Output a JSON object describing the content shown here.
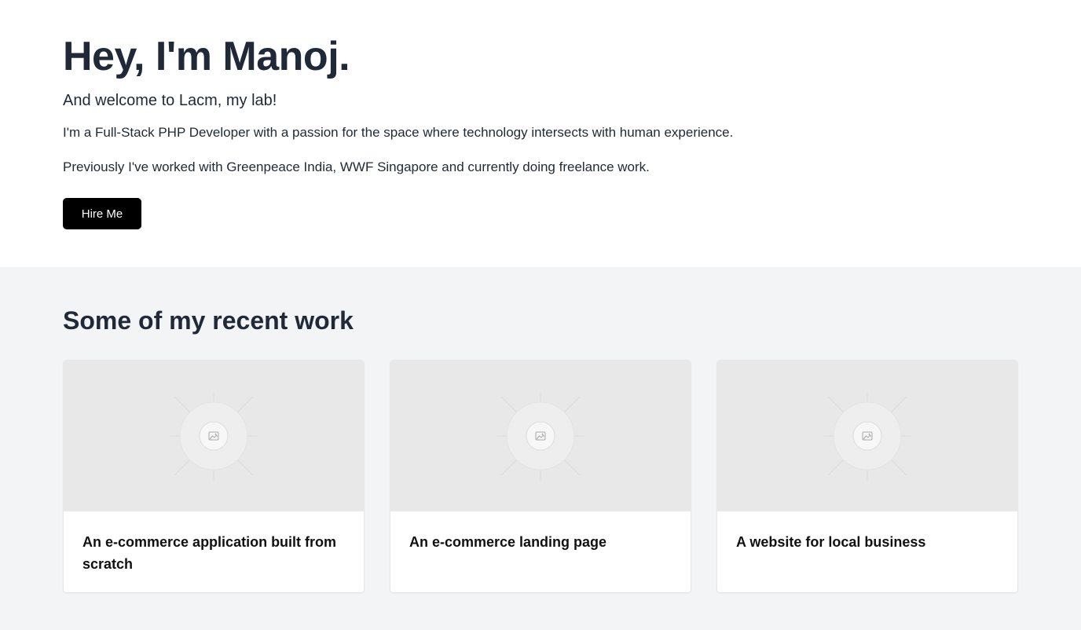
{
  "hero": {
    "heading": "Hey, I'm Manoj.",
    "welcome": "And welcome to Lacm, my lab!",
    "intro": "I'm a Full-Stack PHP Developer with a passion for the space where technology intersects with human experience.",
    "previous": "Previously I've worked with Greenpeace India, WWF Singapore and currently doing freelance work.",
    "hire_label": "Hire Me"
  },
  "work": {
    "heading": "Some of my recent work",
    "projects": [
      {
        "title": "An e-commerce application built from scratch",
        "thumb_icon": "image-placeholder-icon"
      },
      {
        "title": "An e-commerce landing page",
        "thumb_icon": "image-placeholder-icon"
      },
      {
        "title": "A website for local business",
        "thumb_icon": "image-placeholder-icon"
      }
    ]
  },
  "colors": {
    "text": "#1f2937",
    "button_bg": "#000000",
    "section_bg": "#f3f4f6",
    "placeholder_bg": "#e8e8e8"
  }
}
